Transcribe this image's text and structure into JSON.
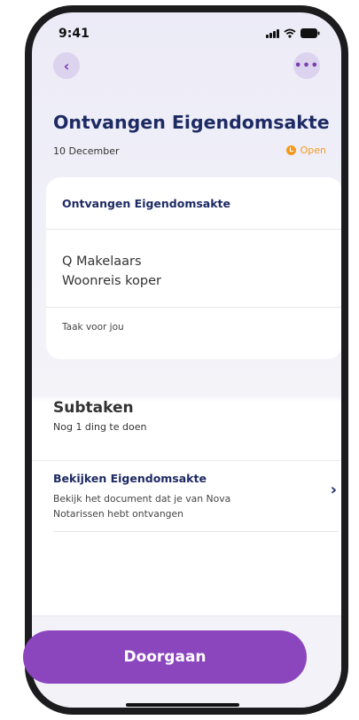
{
  "status_bar": {
    "time": "9:41"
  },
  "header": {
    "back_icon": "chevron-left-icon",
    "more_icon": "ellipsis-icon",
    "title": "Ontvangen Eigendomsakte",
    "date": "10 December",
    "status": "Open",
    "status_color": "#f29a1f"
  },
  "card": {
    "title": "Ontvangen Eigendomsakte",
    "line1": "Q Makelaars",
    "line2": "Woonreis koper",
    "note": "Taak voor jou"
  },
  "subtasks": {
    "title": "Subtaken",
    "subtitle": "Nog 1 ding te doen",
    "items": [
      {
        "title": "Bekijken Eigendomsakte",
        "description": "Bekijk het document dat je van Nova Notarissen hebt ontvangen"
      }
    ]
  },
  "footer": {
    "button_label": "Doorgaan",
    "accent_color": "#8b46be"
  }
}
